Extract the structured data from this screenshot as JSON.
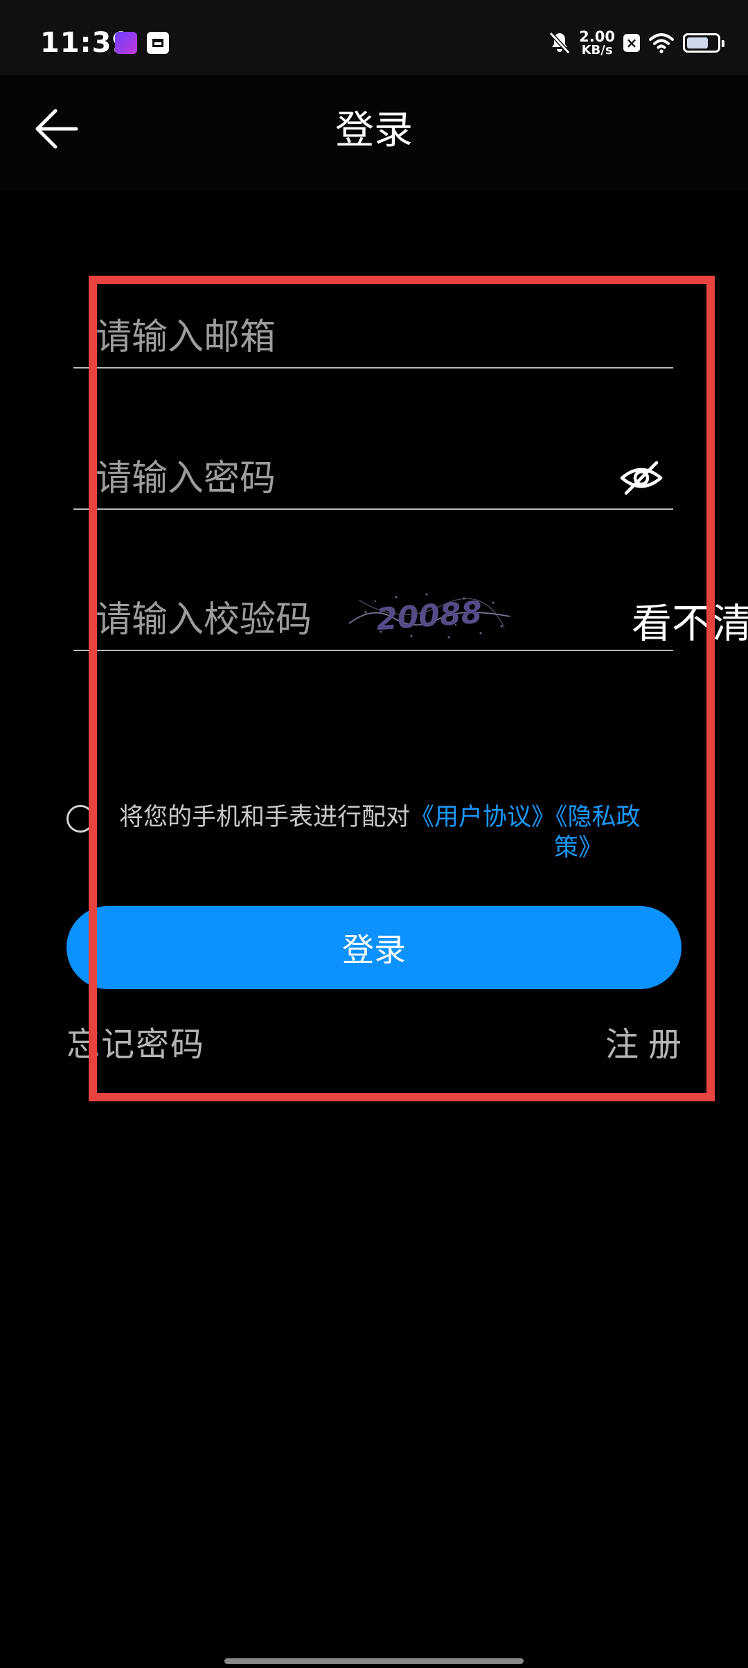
{
  "status_bar": {
    "time": "11:39",
    "net_speed_value": "2.00",
    "net_speed_unit": "KB/s",
    "battery_level": 0.72,
    "icons": [
      "app-notification-icon",
      "app-box-icon",
      "mute-bell-icon",
      "x-box-icon",
      "wifi-icon",
      "battery-icon"
    ]
  },
  "header": {
    "title": "登录",
    "back_icon": "arrow-left-icon"
  },
  "form": {
    "email_placeholder": "请输入邮箱",
    "email_value": "",
    "password_placeholder": "请输入密码",
    "password_value": "",
    "password_toggle_icon": "eye-off-icon",
    "captcha_placeholder": "请输入校验码",
    "captcha_value": "",
    "captcha_image_text": "20088",
    "captcha_refresh_label": "看不清"
  },
  "agreement": {
    "checked": false,
    "text": "将您的手机和手表进行配对",
    "user_agreement": "《用户协议》",
    "privacy_part1": "《隐私政",
    "privacy_part2": "策》"
  },
  "actions": {
    "login_label": "登录",
    "forgot_password_label": "忘记密码",
    "register_label": "注册"
  },
  "colors": {
    "accent": "#0b92ff",
    "link": "#1a98ff",
    "highlight": "#e8433f",
    "background": "#000000"
  }
}
